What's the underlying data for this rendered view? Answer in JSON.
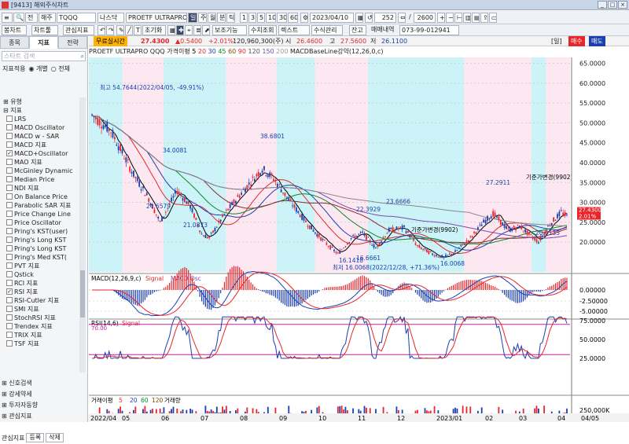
{
  "window": {
    "icon_label": "[9413] 해외주식차트",
    "buttons": [
      "_",
      "□",
      "×"
    ]
  },
  "toolbar1": {
    "rows_label": "전",
    "market": "해주",
    "ticker": "TQQQ",
    "exchange": "나스닥",
    "name": "PROETF ULTRAPRO QQQ",
    "period_selected": "일",
    "periods": [
      "주",
      "월",
      "분",
      "틱",
      "1",
      "3",
      "5",
      "10",
      "30",
      "60"
    ],
    "date": "2023/04/10",
    "count": "252",
    "total": "2600"
  },
  "toolbar2": {
    "items": [
      "봉차트",
      "차트툴",
      "관심지표",
      "초기화",
      "보조기능",
      "수치조회",
      "렉스트",
      "수식관리"
    ],
    "balance_label": "잔고",
    "account_label": "매매내역",
    "account": "073-99-012941"
  },
  "left": {
    "tabs": [
      "종목",
      "지표",
      "전략"
    ],
    "search_placeholder": "스타트 검색",
    "radio_label": "지표적용",
    "radio_opt1": "개별",
    "radio_opt2": "전체",
    "top_nodes": [
      "유형",
      "지표"
    ],
    "items": [
      {
        "label": "LRS",
        "checked": false
      },
      {
        "label": "MACD Oscillator",
        "checked": false
      },
      {
        "label": "MACD w - SAR",
        "checked": false
      },
      {
        "label": "MACD 지표",
        "checked": false
      },
      {
        "label": "MACD+Oscillator",
        "checked": true
      },
      {
        "label": "MAO 지표",
        "checked": false
      },
      {
        "label": "McGinley Dynamic",
        "checked": false
      },
      {
        "label": "Median Price",
        "checked": false
      },
      {
        "label": "NDI 지표",
        "checked": false
      },
      {
        "label": "On Balance Price",
        "checked": false
      },
      {
        "label": "Parabolic SAR 지표",
        "checked": false
      },
      {
        "label": "Price Change Line",
        "checked": false
      },
      {
        "label": "Price Oscillator",
        "checked": false
      },
      {
        "label": "Pring's KST(user)",
        "checked": false
      },
      {
        "label": "Pring's Long KST",
        "checked": false
      },
      {
        "label": "Pring's Long KST",
        "checked": false
      },
      {
        "label": "Pring's Med KST(",
        "checked": false
      },
      {
        "label": "PVT 지표",
        "checked": false
      },
      {
        "label": "Qstick",
        "checked": false
      },
      {
        "label": "RCI 지표",
        "checked": false
      },
      {
        "label": "RSI 지표",
        "checked": true
      },
      {
        "label": "RSI-Cutler 지표",
        "checked": false
      },
      {
        "label": "SMI 지표",
        "checked": false
      },
      {
        "label": "StochRSI 지표",
        "checked": false
      },
      {
        "label": "Trendex 지표",
        "checked": false
      },
      {
        "label": "TRIX 지표",
        "checked": false
      },
      {
        "label": "TSF 지표",
        "checked": false
      }
    ],
    "groups": [
      "신호검색",
      "강세약세",
      "투자자동향",
      "관심지표"
    ],
    "footer": [
      "관심지표",
      "등록",
      "삭제"
    ]
  },
  "info": {
    "mode": "무료실시간",
    "price": "27.4300",
    "change": "▲0.5400",
    "pct": "+2.01%",
    "volume": "120,960,300(주)",
    "open_label": "시",
    "open": "26.4600",
    "high_label": "고",
    "high": "27.5600",
    "low_label": "저",
    "low": "26.1100",
    "right_tags": [
      "[일]",
      "매수",
      "매도"
    ]
  },
  "legend": {
    "name": "PROETF ULTRAPRO QQQ",
    "ma_label": "가격이평",
    "ma_periods": [
      "5",
      "20",
      "30",
      "45",
      "60",
      "90",
      "120",
      "150",
      "200"
    ],
    "extra": "MACDBaseLine강약(12,26,0,c)"
  },
  "price_axis": [
    "65.0000",
    "60.0000",
    "55.0000",
    "50.0000",
    "45.0000",
    "40.0000",
    "35.0000",
    "30.0000",
    "25.0000",
    "20.0000"
  ],
  "current_price_tag": [
    "27.4300",
    "2.01%"
  ],
  "annotations": [
    {
      "text": "최고 54.7644(2022/04/05, -49.91%)"
    },
    {
      "text": "38.6801"
    },
    {
      "text": "34.0081"
    },
    {
      "text": "24.6579"
    },
    {
      "text": "21.0873"
    },
    {
      "text": "22.3929"
    },
    {
      "text": "23.6666"
    },
    {
      "text": "16.1418"
    },
    {
      "text": "16.6661"
    },
    {
      "text": "16.0068"
    },
    {
      "text": "최저 16.0068(2022/12/28, +71.36%)"
    },
    {
      "text": "27.2911"
    },
    {
      "text": "20.0135"
    },
    {
      "text": "기준가변경(9902)"
    },
    {
      "text": "기준가변경(9902)"
    }
  ],
  "macd": {
    "title": "MACD(12,26,9,c)",
    "signal": "Signal",
    "osc": "MACD Osc",
    "axis": [
      "0.00000",
      "-2.50000",
      "-5.00000"
    ]
  },
  "rsi": {
    "title": "RSI(14,6)",
    "signal": "Signal",
    "axis": [
      "75.0000",
      "50.0000",
      "25.0000"
    ],
    "level": "70.00"
  },
  "volume": {
    "title": "거래이평",
    "periods": [
      "5",
      "20",
      "60",
      "120"
    ],
    "label": "거래량",
    "axis": [
      "250,000K",
      "0"
    ]
  },
  "date_axis": [
    "2022/04",
    "05",
    "06",
    "07",
    "08",
    "09",
    "10",
    "11",
    "12",
    "2023/01",
    "02",
    "03",
    "04"
  ],
  "date_axis_right": "04/05",
  "colors": {
    "up": "#e8252b",
    "down": "#1b3fb0",
    "cyan_zone": "#ccf3f7",
    "pink_zone": "#fde8f2"
  }
}
